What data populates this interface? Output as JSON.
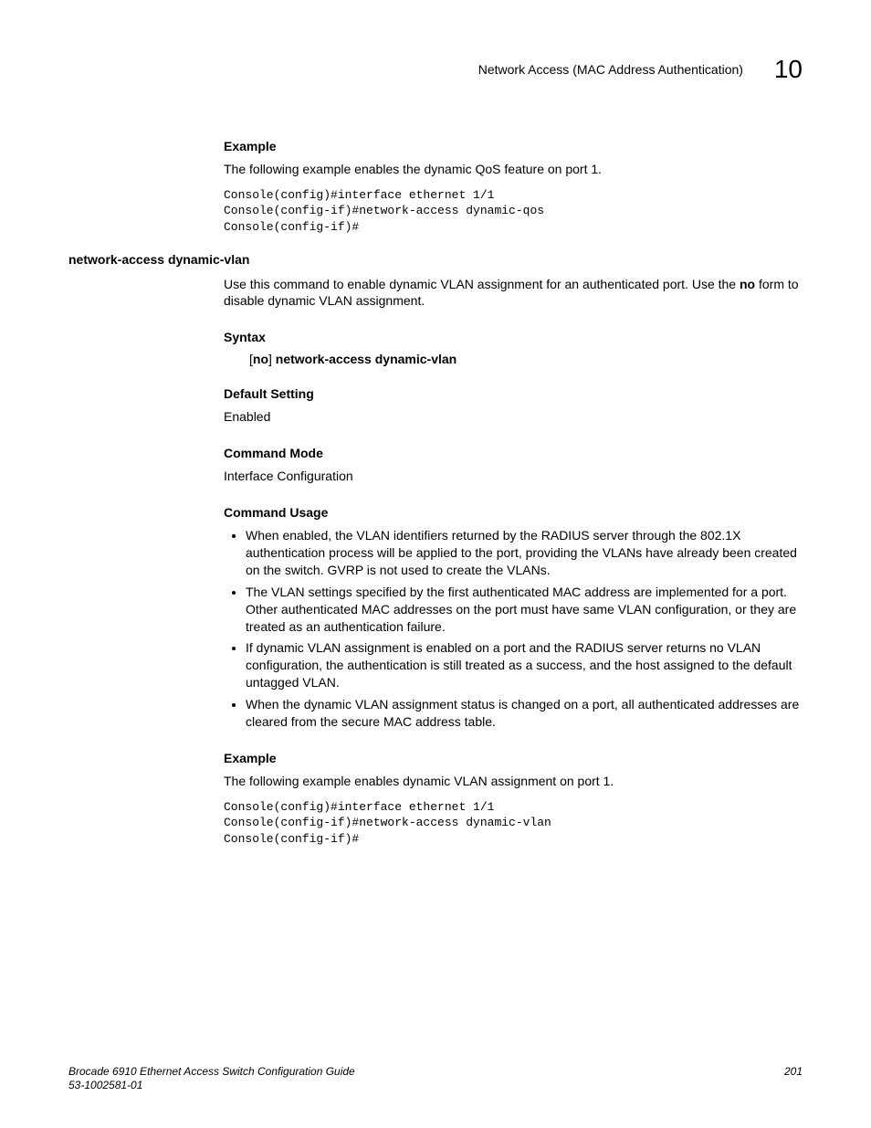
{
  "header": {
    "title": "Network Access (MAC Address Authentication)",
    "chapter": "10"
  },
  "section1": {
    "heading": "Example",
    "intro": "The following example enables the dynamic QoS feature on port 1.",
    "code": "Console(config)#interface ethernet 1/1\nConsole(config-if)#network-access dynamic-qos\nConsole(config-if)#"
  },
  "command": {
    "name": "network-access dynamic-vlan",
    "desc_pre": "Use this command to enable dynamic VLAN assignment for an authenticated port. Use the ",
    "desc_bold": "no",
    "desc_post": " form to disable dynamic VLAN assignment.",
    "syntax": {
      "heading": "Syntax",
      "bracket_open": "[",
      "no": "no",
      "bracket_close": "] ",
      "cmd": "network-access dynamic-vlan"
    },
    "default": {
      "heading": "Default Setting",
      "value": "Enabled"
    },
    "mode": {
      "heading": "Command Mode",
      "value": "Interface Configuration"
    },
    "usage": {
      "heading": "Command Usage",
      "items": [
        "When enabled, the VLAN identifiers returned by the RADIUS server through the 802.1X authentication process will be applied to the port, providing the VLANs have already been created on the switch. GVRP is not used to create the VLANs.",
        "The VLAN settings specified by the first authenticated MAC address are implemented for a port. Other authenticated MAC addresses on the port must have same VLAN configuration, or they are treated as an authentication failure.",
        "If dynamic VLAN assignment is enabled on a port and the RADIUS server returns no VLAN configuration, the authentication is still treated as a success, and the host assigned to the default untagged VLAN.",
        "When the dynamic VLAN assignment status is changed on a port, all authenticated addresses are cleared from the secure MAC address table."
      ]
    },
    "example": {
      "heading": "Example",
      "intro": "The following example enables dynamic VLAN assignment on port 1.",
      "code": "Console(config)#interface ethernet 1/1\nConsole(config-if)#network-access dynamic-vlan\nConsole(config-if)#"
    }
  },
  "footer": {
    "book": "Brocade 6910 Ethernet Access Switch Configuration Guide",
    "docnum": "53-1002581-01",
    "page": "201"
  }
}
